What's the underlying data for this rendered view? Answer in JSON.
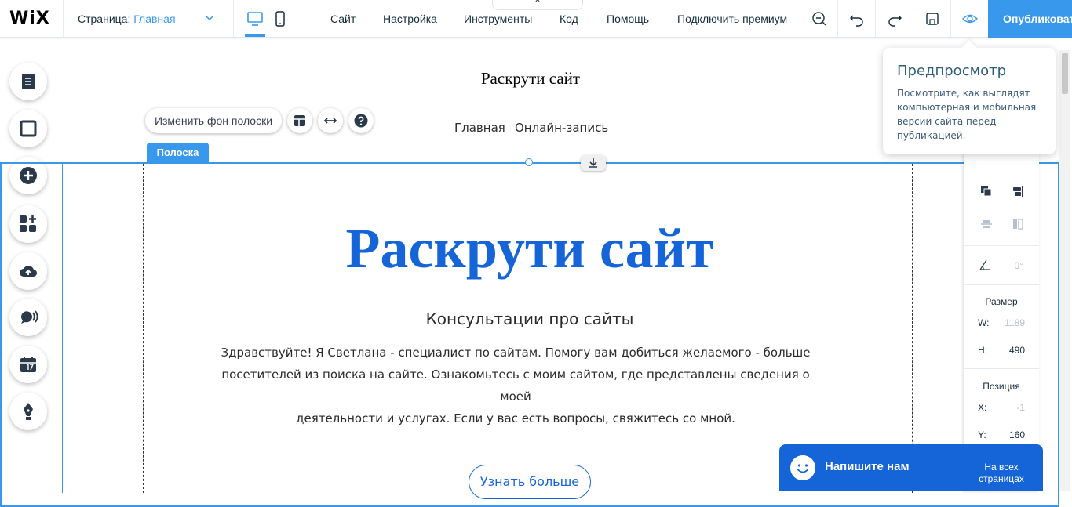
{
  "topbar": {
    "logo": "WiX",
    "page_label": "Страница: ",
    "page_value": "Главная",
    "menu": [
      "Сайт",
      "Настройка",
      "Инструменты",
      "Код",
      "Помощь",
      "Подключить премиум"
    ],
    "tools_tab_glyph": "⌃",
    "publish_label": "Опубликовать"
  },
  "canvas": {
    "site_header_title": "Раскрути сайт",
    "nav": [
      "Главная",
      "Онлайн-запись"
    ],
    "strip_bg_button": "Изменить фон полоски",
    "strip_tag": "Полоска",
    "hero_title": "Раскрути сайт",
    "hero_subtitle": "Консультации про сайты",
    "hero_body_lines": [
      "Здравствуйте! Я Светлана - специалист по сайтам. Помогу вам добиться желаемого - больше",
      "посетителей из поиска на сайте. Ознакомьтесь с моим сайтом, где представлены сведения о моей",
      "деятельности и услугах. Если у вас есть вопросы, свяжитесь со мной."
    ],
    "learn_more": "Узнать больше"
  },
  "inspector": {
    "rotation": "0°",
    "size_label": "Размер",
    "w_key": "W:",
    "w_val": "1189",
    "h_key": "H:",
    "h_val": "490",
    "position_label": "Позиция",
    "x_key": "X:",
    "x_val": "-1",
    "y_key": "Y:",
    "y_val": "160",
    "all_pages": "На всех страницах"
  },
  "preview_tooltip": {
    "title": "Предпросмотр",
    "text": "Посмотрите, как выглядят компьютерная и мобильная версии сайта перед публикацией."
  },
  "chat": {
    "label": "Напишите нам"
  },
  "colors": {
    "accent": "#3899ec",
    "hero_blue": "#1565d8"
  }
}
